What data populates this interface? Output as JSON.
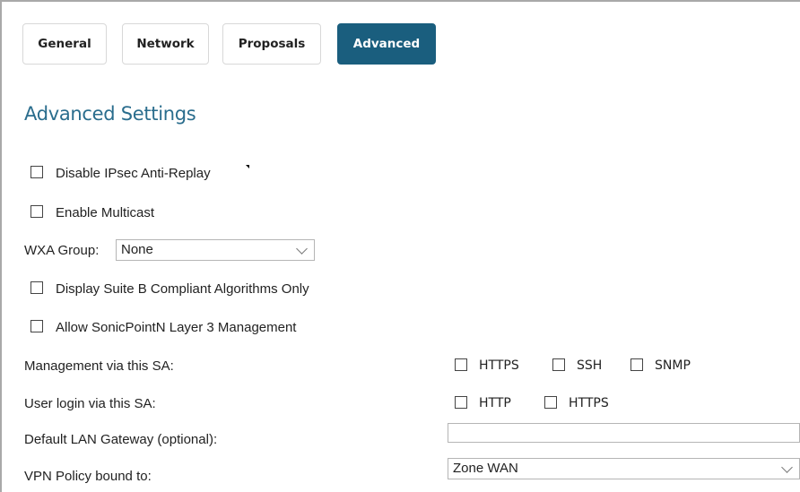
{
  "tabs": [
    {
      "label": "General",
      "active": false
    },
    {
      "label": "Network",
      "active": false
    },
    {
      "label": "Proposals",
      "active": false
    },
    {
      "label": "Advanced",
      "active": true
    }
  ],
  "heading": "Advanced Settings",
  "options": {
    "disable_anti_replay": {
      "label": "Disable IPsec Anti-Replay",
      "checked": false
    },
    "enable_multicast": {
      "label": "Enable Multicast",
      "checked": false
    },
    "suite_b": {
      "label": "Display Suite B Compliant Algorithms Only",
      "checked": false
    },
    "sonicpoint_l3": {
      "label": "Allow SonicPointN Layer 3 Management",
      "checked": false
    }
  },
  "wxa_group": {
    "label": "WXA Group:",
    "value": "None"
  },
  "management": {
    "label": "Management via this SA:",
    "https": "HTTPS",
    "ssh": "SSH",
    "snmp": "SNMP"
  },
  "user_login": {
    "label": "User login via this SA:",
    "http": "HTTP",
    "https": "HTTPS"
  },
  "default_gateway": {
    "label": "Default LAN Gateway (optional):",
    "value": ""
  },
  "vpn_policy": {
    "label": "VPN Policy bound to:",
    "value": "Zone WAN"
  },
  "colors": {
    "accent": "#1a5e7e",
    "heading": "#2a6d8d"
  }
}
